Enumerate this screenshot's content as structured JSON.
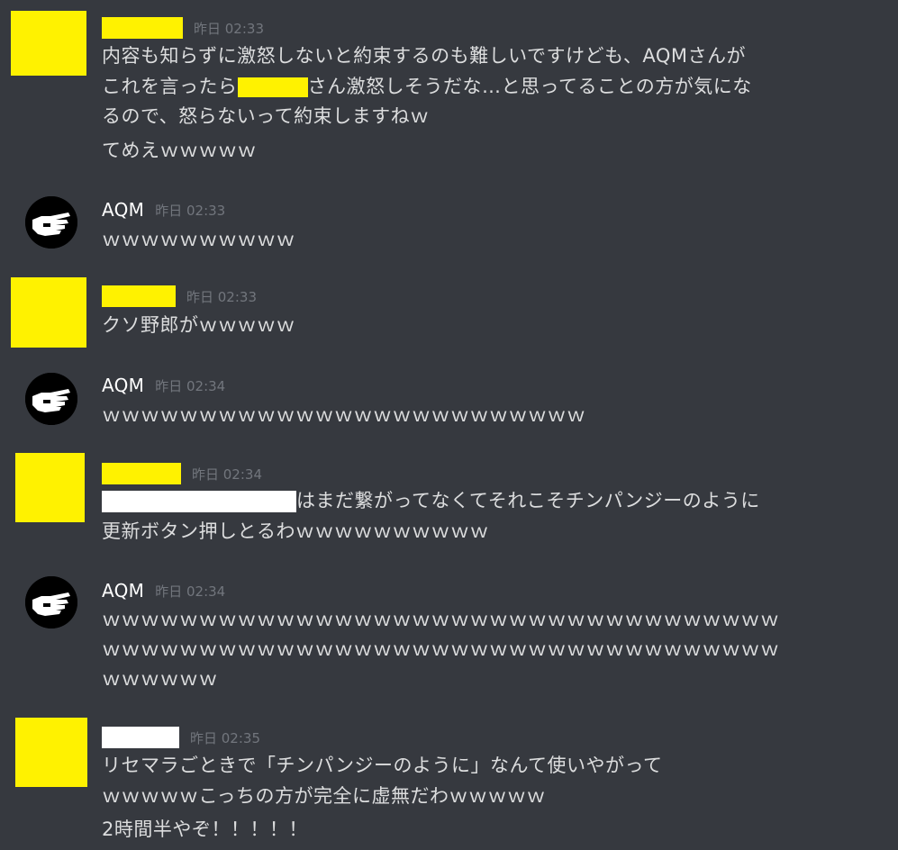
{
  "messages": [
    {
      "author": "",
      "timestamp": "昨日 02:33",
      "lines": [
        "内容も知らずに激怒しないと約束するのも難しいですけども、AQMさんが",
        {
          "before": "これを言ったら",
          "after": "さん激怒しそうだな…と思ってることの方が気にな"
        },
        "るので、怒らないって約束しますねｗ"
      ],
      "extra": "てめえｗｗｗｗｗ"
    },
    {
      "author": "AQM",
      "timestamp": "昨日 02:33",
      "lines": [
        "ｗｗｗｗｗｗｗｗｗｗ"
      ]
    },
    {
      "author": "",
      "timestamp": "昨日 02:33",
      "lines": [
        "クソ野郎がｗｗｗｗｗ"
      ]
    },
    {
      "author": "AQM",
      "timestamp": "昨日 02:34",
      "lines": [
        "ｗｗｗｗｗｗｗｗｗｗｗｗｗｗｗｗｗｗｗｗｗｗｗｗｗ"
      ]
    },
    {
      "author": "",
      "timestamp": "昨日 02:34",
      "lines": [
        {
          "before": "",
          "after": "はまだ繋がってなくてそれこそチンパンジーのように"
        },
        "更新ボタン押しとるわｗｗｗｗｗｗｗｗｗｗ"
      ]
    },
    {
      "author": "AQM",
      "timestamp": "昨日 02:34",
      "lines": [
        "ｗｗｗｗｗｗｗｗｗｗｗｗｗｗｗｗｗｗｗｗｗｗｗｗｗｗｗｗｗｗｗｗｗｗｗ",
        "ｗｗｗｗｗｗｗｗｗｗｗｗｗｗｗｗｗｗｗｗｗｗｗｗｗｗｗｗｗｗｗｗｗｗｗ",
        "ｗｗｗｗｗｗ"
      ]
    },
    {
      "author": "",
      "timestamp": "昨日 02:35",
      "lines": [
        "リセマラごときで「チンパンジーのように」なんて使いやがって",
        "ｗｗｗｗｗこっちの方が完全に虚無だわｗｗｗｗｗ"
      ],
      "extra": "2時間半やぞ！！！！！"
    }
  ],
  "colors": {
    "background": "#36393f",
    "text": "#dcddde",
    "username": "#ffffff",
    "timestamp": "#72767d",
    "redact_yellow": "#fff200",
    "redact_white": "#ffffff"
  }
}
